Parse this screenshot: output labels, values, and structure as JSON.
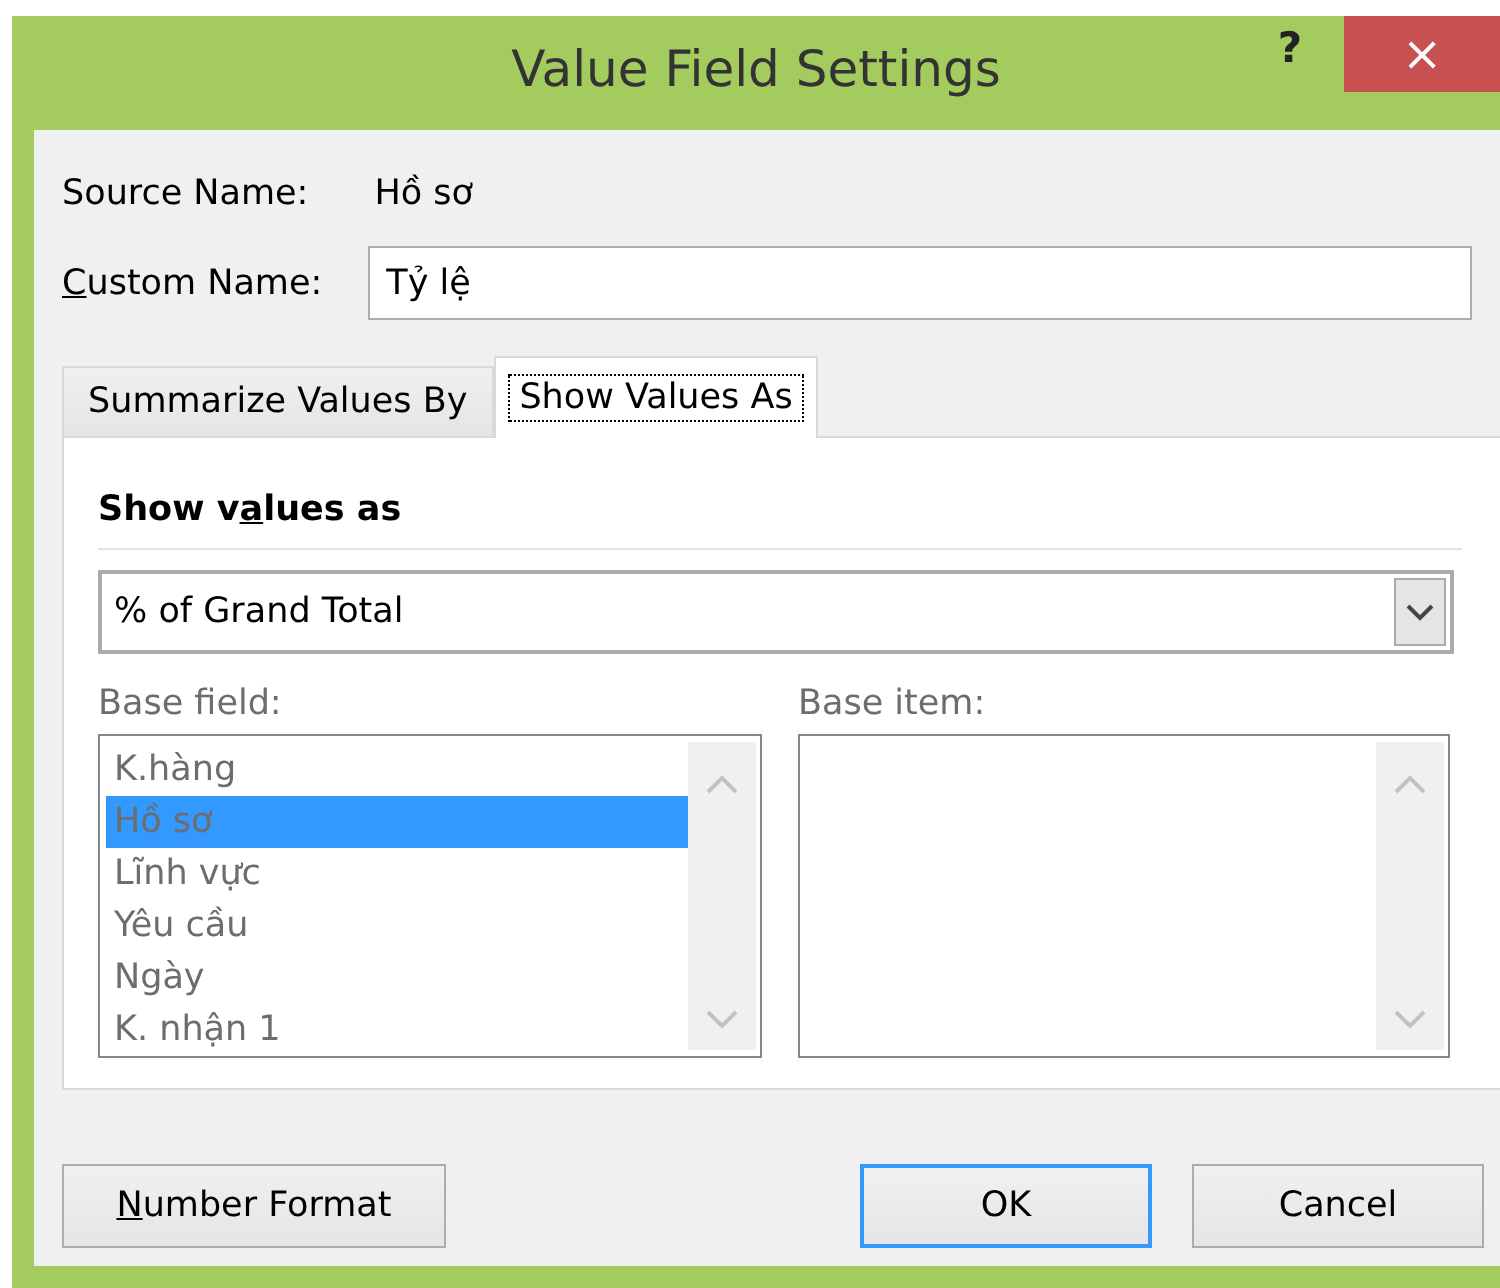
{
  "window": {
    "title": "Value Field Settings",
    "help": "?",
    "close": "×"
  },
  "source_name": {
    "label": "Source Name:",
    "value": "Hồ sơ"
  },
  "custom_name": {
    "access_key": "C",
    "label_post": "ustom Name:",
    "value": "Tỷ lệ"
  },
  "tabs": [
    {
      "label": "Summarize Values By",
      "selected": false
    },
    {
      "label": "Show Values As",
      "selected": true
    }
  ],
  "show_values_as": {
    "heading_pre": "Show v",
    "access_key": "a",
    "heading_post": "lues as",
    "value": "% of Grand Total"
  },
  "base_field": {
    "label": "Base field:",
    "disabled": true,
    "items": [
      {
        "label": "K.hàng",
        "selected": false
      },
      {
        "label": "Hồ sơ",
        "selected": true
      },
      {
        "label": "Lĩnh vực",
        "selected": false
      },
      {
        "label": "Yêu cầu",
        "selected": false
      },
      {
        "label": "Ngày",
        "selected": false
      },
      {
        "label": "K. nhận 1",
        "selected": false
      }
    ]
  },
  "base_item": {
    "label": "Base item:",
    "disabled": true
  },
  "number_format_button": {
    "access_key": "N",
    "label_post": "umber Format"
  },
  "buttons": [
    {
      "label": "OK",
      "default": true
    },
    {
      "label": "Cancel",
      "default": false
    }
  ]
}
